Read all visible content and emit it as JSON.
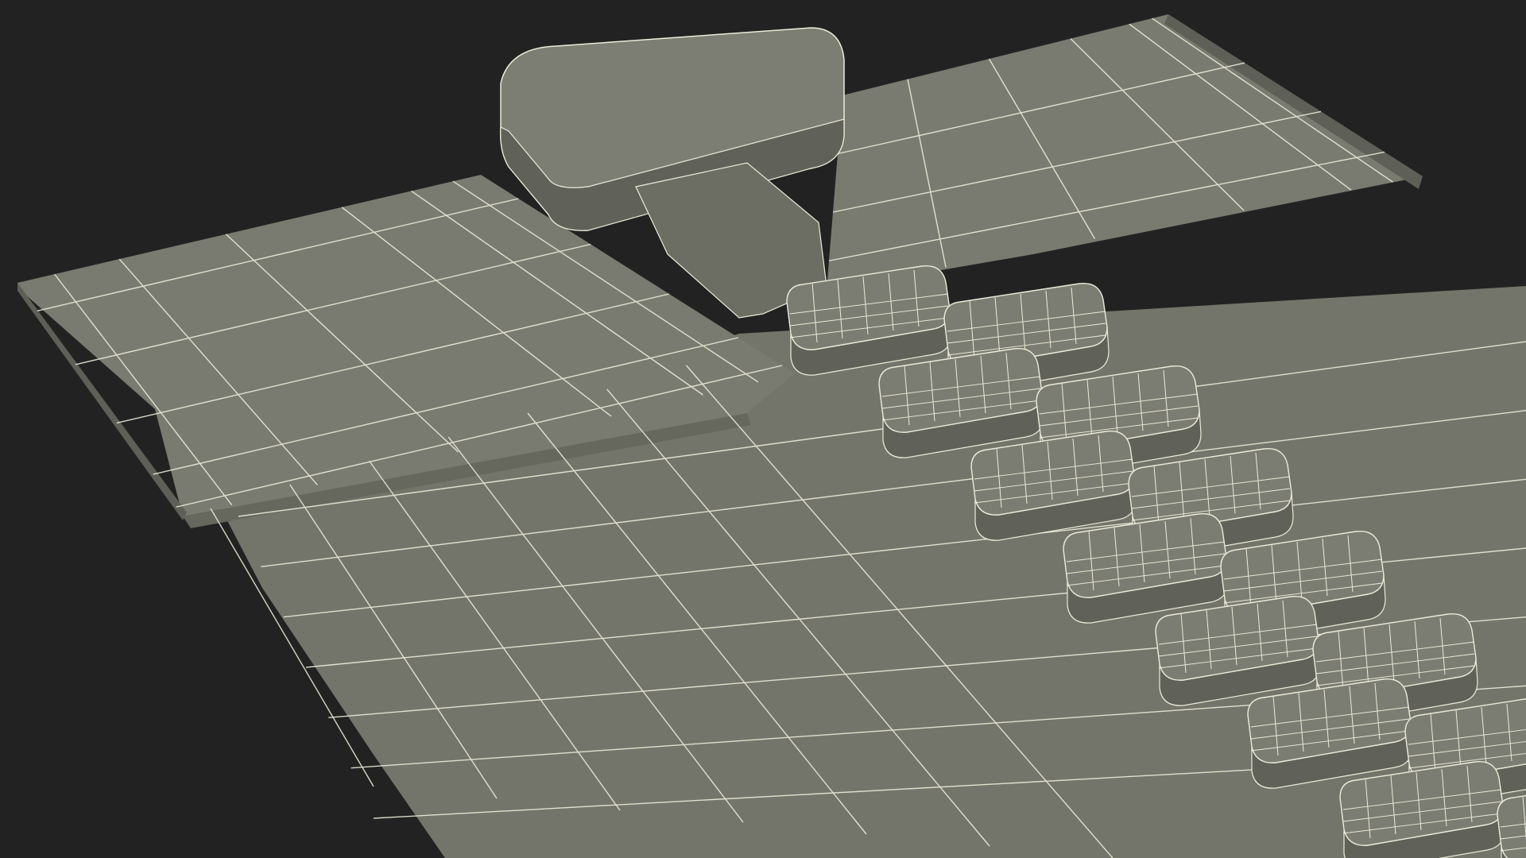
{
  "scene": {
    "subject": "zipper-wireframe-render",
    "colors": {
      "background": "#222222",
      "surface": "#75766b",
      "surface_light": "#828377",
      "surface_dark": "#5d5e55",
      "tooth_top": "#7c7d72",
      "tooth_side": "#606158",
      "wire": "#ecebd9"
    },
    "tooth_count": 14,
    "icons": [
      "slider-tab",
      "zipper-teeth",
      "fabric-tape"
    ]
  }
}
